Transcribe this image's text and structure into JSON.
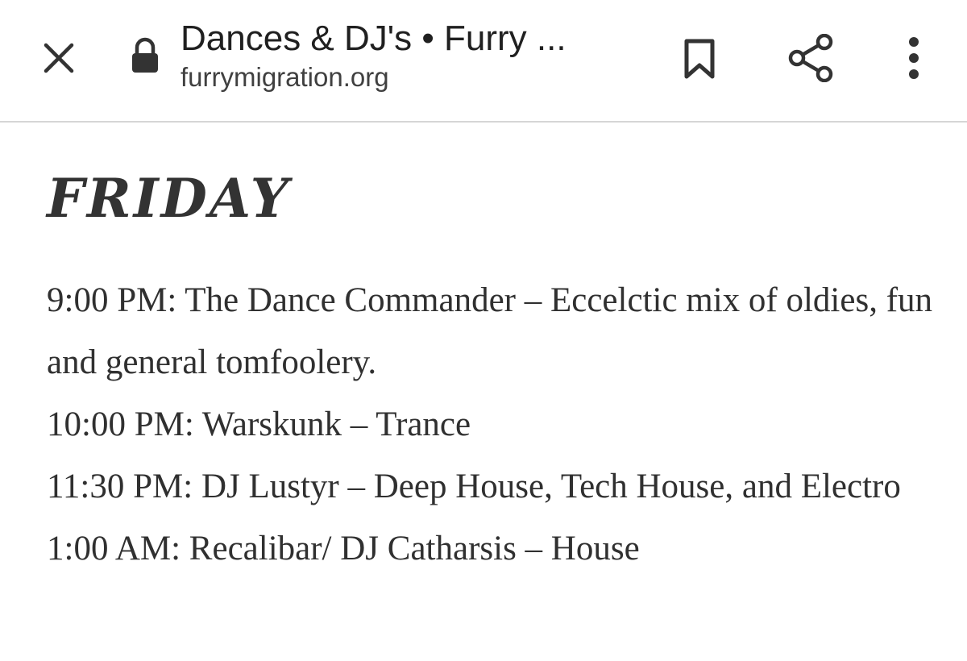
{
  "header": {
    "title": "Dances & DJ's • Furry ...",
    "url": "furrymigration.org",
    "icons": {
      "close": "close-icon",
      "lock": "lock-icon",
      "bookmark": "bookmark-icon",
      "share": "share-icon",
      "more": "more-vert-icon"
    }
  },
  "content": {
    "heading": "FRIDAY",
    "schedule": [
      "9:00 PM: The Dance Commander – Eccelctic mix of oldies, fun and general tomfoolery.",
      "10:00 PM: Warskunk – Trance",
      "11:30 PM: DJ Lustyr – Deep House, Tech House, and Electro",
      "1:00 AM: Recalibar/ DJ Catharsis – House"
    ]
  },
  "colors": {
    "text": "#303030",
    "background": "#ffffff",
    "divider": "#d6d6d6"
  }
}
